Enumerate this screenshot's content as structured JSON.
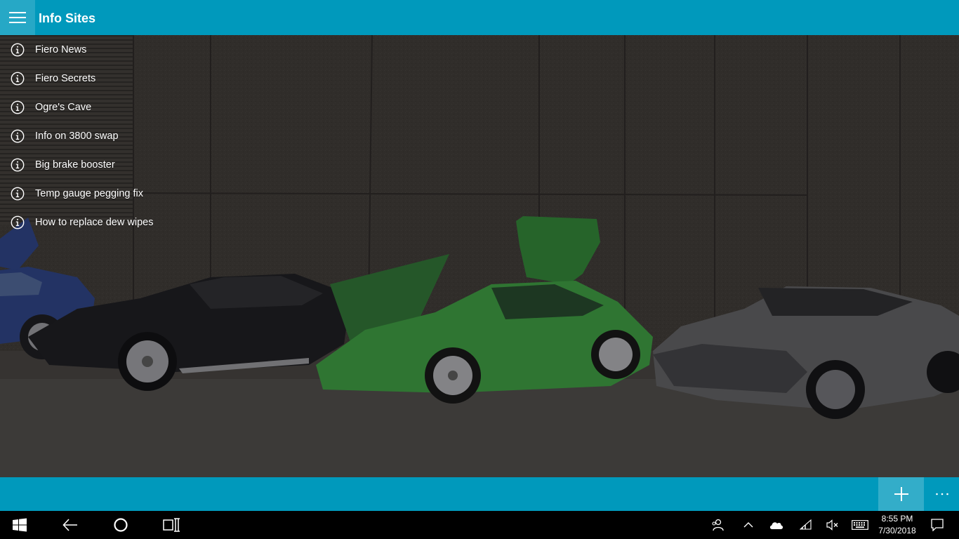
{
  "app": {
    "title": "Info Sites"
  },
  "sites": [
    {
      "label": "Fiero News"
    },
    {
      "label": "Fiero Secrets"
    },
    {
      "label": "Ogre's Cave"
    },
    {
      "label": "Info on 3800 swap"
    },
    {
      "label": "Big brake booster"
    },
    {
      "label": "Temp gauge pegging fix"
    },
    {
      "label": "How to replace dew wipes"
    }
  ],
  "icons": {
    "site": "info-icon",
    "menu": "hamburger-icon",
    "add": "plus-icon",
    "more": "ellipsis-icon"
  },
  "colors": {
    "accent": "#0099bc",
    "accent_light": "#33adc9",
    "taskbar": "#000000"
  },
  "taskbar": {
    "time": "8:55 PM",
    "date": "7/30/2018"
  }
}
